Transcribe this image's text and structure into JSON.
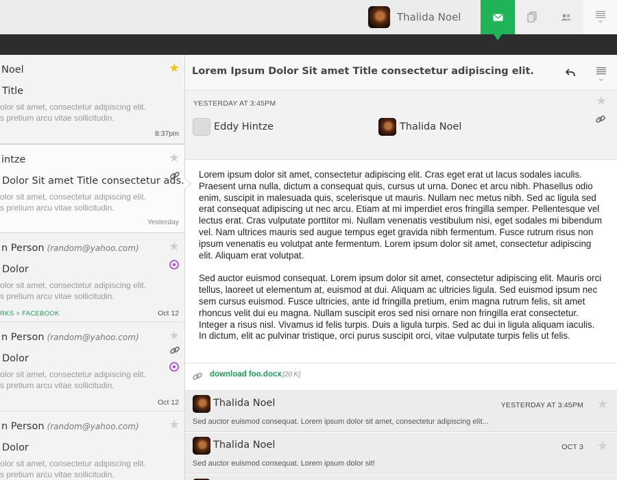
{
  "header": {
    "user_name": "Thalida Noel",
    "nav": [
      "mail-icon",
      "documents-icon",
      "contacts-icon",
      "menu-icon"
    ],
    "accent": "#21b357"
  },
  "list": {
    "items": [
      {
        "sender": "Noel",
        "email": "",
        "subject": "Title",
        "snippet1": "olor sit amet, consectetur adipiscing elit.",
        "snippet2": "s pretium arcu vitae sollicitudin.",
        "time": "8:37pm",
        "starred": true,
        "tags": ""
      },
      {
        "sender": "intze",
        "email": "",
        "subject": "Dolor Sit amet Title consectetur ads...",
        "snippet1": "olor sit amet, consectetur adipiscing elit.",
        "snippet2": "s pretium arcu vitae sollicitudin.",
        "time": "Yesterday",
        "starred": false,
        "tags": ""
      },
      {
        "sender": "n Person",
        "email": "(random@yahoo.com)",
        "subject": "Dolor",
        "snippet1": "olor sit amet, consectetur adipiscing elit.",
        "snippet2": "s pretium arcu vitae sollicitudin.",
        "time": "Oct 12",
        "starred": false,
        "tags": "RKS > FACEBOOK"
      },
      {
        "sender": "n Person",
        "email": "(random@yahoo.com)",
        "subject": "Dolor",
        "snippet1": "olor sit amet, consectetur adipiscing elit.",
        "snippet2": "s pretium arcu vitae sollicitudin.",
        "time": "Oct 12",
        "starred": false,
        "tags": ""
      },
      {
        "sender": "n Person",
        "email": "(random@yahoo.com)",
        "subject": "Dolor",
        "snippet1": "olor sit amet, consectetur adipiscing elit.",
        "snippet2": "s pretium arcu vitae sollicitudin.",
        "time": "",
        "starred": false,
        "tags": ""
      }
    ]
  },
  "detail": {
    "title": "Lorem Ipsum Dolor Sit amet Title consectetur adipiscing elit.",
    "date": "YESTERDAY AT 3:45PM",
    "from": "Eddy Hintze",
    "to": "Thalida Noel",
    "paragraphs": [
      "Lorem ipsum dolor sit amet, consectetur adipiscing elit. Cras eget erat ut lacus sodales iaculis. Praesent urna nulla, dictum a consequat quis, cursus ut urna. Donec et arcu nibh. Phasellus odio enim, suscipit in malesuada quis, scelerisque ut mauris. Nullam nec metus nibh. Sed ac ligula sed erat consequat adipiscing ut nec arcu. Etiam at mi imperdiet eros fringilla semper. Pellentesque vel lectus erat. Cras vulputate porttitor mi. Nullam venenatis vestibulum nisi, eget sodales mi bibendum vel. Nam ultrices mauris sed augue tempus eget gravida nibh fermentum. Fusce rutrum risus non ipsum venenatis eu volutpat ante fermentum. Lorem ipsum dolor sit amet, consectetur adipiscing elit. Aliquam erat volutpat.",
      "Sed auctor euismod consequat. Lorem ipsum dolor sit amet, consectetur adipiscing elit. Mauris orci tellus, laoreet ut elementum at, euismod at dui. Aliquam ac ultricies ligula. Sed euismod ipsum nec sem cursus euismod. Fusce ultricies, ante id fringilla pretium, enim magna rutrum felis, sit amet rhoncus velit dui eu magna. Nullam suscipit eros sed nisi ornare non fringilla erat consecte­tur. Integer a risus nisl. Vivamus id felis turpis. Duis a ligula turpis. Sed ac dui in ligula aliquam iaculis. In dictum, elit ac pulvinar tristique, orci purus suscipit orci, vitae vulputate turpis felis ut felis."
    ],
    "attachment": {
      "name": "download foo.docx",
      "size": "[20 K]"
    },
    "replies": [
      {
        "name": "Thalida Noel",
        "date": "YESTERDAY AT 3:45PM",
        "text": "Sed auctor euismod consequat. Lorem ipsum dolor sit amet, consectetur adipiscing elit..."
      },
      {
        "name": "Thalida Noel",
        "date": "OCT 3",
        "text": "Sed auctor euismod consequat. Lorem ipsum dolor sit!"
      }
    ]
  }
}
